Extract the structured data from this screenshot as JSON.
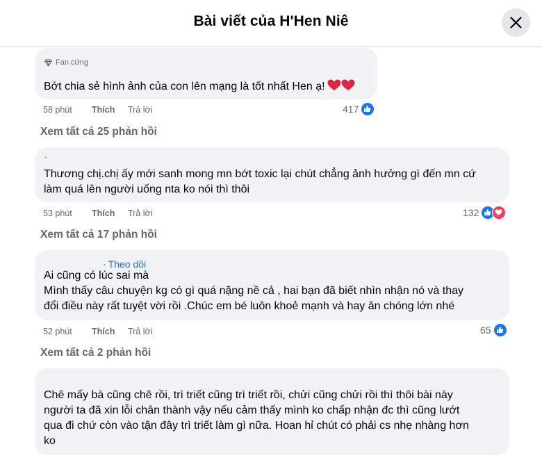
{
  "header": {
    "title": "Bài viết của H'Hen Niê"
  },
  "comments": [
    {
      "badge": "Fan cứng",
      "text": "Bớt chia sẻ hình ảnh của con lên mạng là tốt nhất Hen ạ!",
      "time": "58 phút",
      "like_label": "Thích",
      "reply_label": "Trả lời",
      "reaction_count": "417",
      "view_replies": "Xem tất cả 25 phản hồi"
    },
    {
      "author_mark": ".",
      "text": "Thương chị.chị ấy mới sanh mong mn bớt toxic lại chút chẳng ảnh hưởng gì đến mn cứ\nlàm quá lên người uống nta ko nói thì thôi",
      "time": "53 phút",
      "like_label": "Thích",
      "reply_label": "Trả lời",
      "reaction_count": "132",
      "view_replies": "Xem tất cả 17 phản hồi"
    },
    {
      "follow_label": "Theo dõi",
      "text": "Ai cũng có lúc sai mà\nMình thấy câu chuyện kg có gì quá nặng nề cả , hai bạn đã biết nhìn nhận nó và thay\nđổi điều này rất tuyệt vời rồi .Chúc em bé luôn khoẻ mạnh và hay ăn chóng lớn nhé",
      "time": "52 phút",
      "like_label": "Thích",
      "reply_label": "Trả lời",
      "reaction_count": "65",
      "view_replies": "Xem tất cả 2 phản hồi"
    },
    {
      "text": "Chê mấy bà cũng chê rồi, trì triết cũng trì triết rồi, chửi cũng chửi rồi thì thôi bài này\nngười ta đã xin lỗi chân thành vậy nếu cảm thấy mình ko chấp nhận đc thì cũng lướt\nqua đi chứ còn vào tận đây trì triết làm gì nữa. Hoan hỉ chút có phải cs nhẹ nhàng hơn\nko"
    }
  ],
  "colors": {
    "bubble": "#f0f2f5",
    "link": "#216fdb",
    "secondary_text": "#65676b",
    "like_blue": "#1877f2",
    "love_red": "#f33e58"
  },
  "icons": [
    "close-icon",
    "diamond-icon",
    "heart-emoji",
    "like-reaction-icon",
    "love-reaction-icon"
  ]
}
